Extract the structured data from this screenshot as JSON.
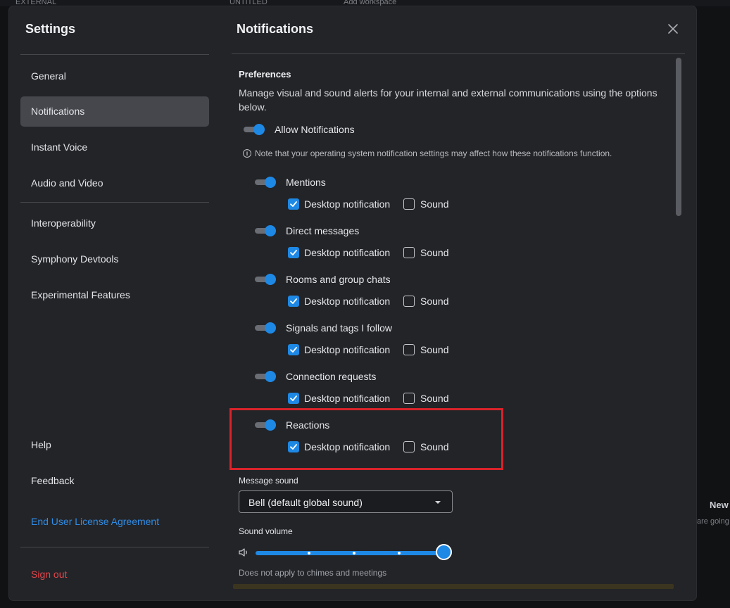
{
  "background": {
    "tab_external": "EXTERNAL",
    "tab_untitled": "UNTITLED",
    "add_workspace": "Add workspace",
    "right_new": "New",
    "right_snippet": "are going"
  },
  "sidebar": {
    "title": "Settings",
    "items": [
      {
        "label": "General"
      },
      {
        "label": "Notifications"
      },
      {
        "label": "Instant Voice"
      },
      {
        "label": "Audio and Video"
      },
      {
        "label": "Interoperability"
      },
      {
        "label": "Symphony Devtools"
      },
      {
        "label": "Experimental Features"
      },
      {
        "label": "Help"
      },
      {
        "label": "Feedback"
      }
    ],
    "license_link": "End User License Agreement",
    "sign_out": "Sign out"
  },
  "main": {
    "title": "Notifications",
    "preferences": {
      "heading": "Preferences",
      "description": "Manage visual and sound alerts for your internal and external communications using the options below.",
      "allow_label": "Allow Notifications",
      "allow_enabled": true,
      "note": "Note that your operating system notification settings may affect how these notifications function."
    },
    "desktop_label": "Desktop notification",
    "sound_label": "Sound",
    "categories": [
      {
        "label": "Mentions",
        "enabled": true,
        "desktop": true,
        "sound": false
      },
      {
        "label": "Direct messages",
        "enabled": true,
        "desktop": true,
        "sound": false
      },
      {
        "label": "Rooms and group chats",
        "enabled": true,
        "desktop": true,
        "sound": false
      },
      {
        "label": "Signals and tags I follow",
        "enabled": true,
        "desktop": true,
        "sound": false
      },
      {
        "label": "Connection requests",
        "enabled": true,
        "desktop": true,
        "sound": false
      },
      {
        "label": "Reactions",
        "enabled": true,
        "desktop": true,
        "sound": false
      }
    ],
    "message_sound": {
      "label": "Message sound",
      "value": "Bell (default global sound)"
    },
    "sound_volume": {
      "label": "Sound volume",
      "level": 1.0,
      "hint": "Does not apply to chimes and meetings"
    }
  },
  "colors": {
    "accent": "#1e88e5",
    "highlight": "#d9232a",
    "sign_out": "#e3464b",
    "link": "#2f8ce6"
  }
}
